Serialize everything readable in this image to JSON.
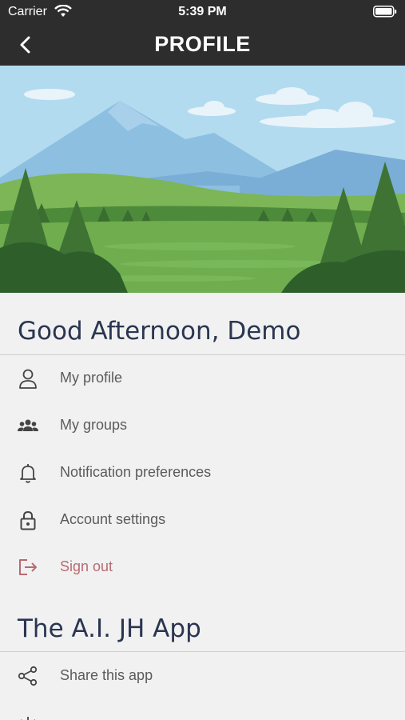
{
  "status": {
    "carrier": "Carrier",
    "time": "5:39 PM"
  },
  "nav": {
    "title": "PROFILE"
  },
  "greeting": "Good Afternoon, Demo",
  "account_items": [
    {
      "label": "My profile",
      "icon": "person-icon"
    },
    {
      "label": "My groups",
      "icon": "group-icon"
    },
    {
      "label": "Notification preferences",
      "icon": "bell-icon"
    },
    {
      "label": "Account settings",
      "icon": "lock-icon"
    },
    {
      "label": "Sign out",
      "icon": "sign-out-icon"
    }
  ],
  "app_section": {
    "title": "The A.I. JH App",
    "items": [
      {
        "label": "Share this app",
        "icon": "share-icon"
      }
    ]
  },
  "colors": {
    "header": "#2d2d2d",
    "background": "#f1f1f1",
    "heading": "#2a3550",
    "sign_out": "#b66b72"
  }
}
